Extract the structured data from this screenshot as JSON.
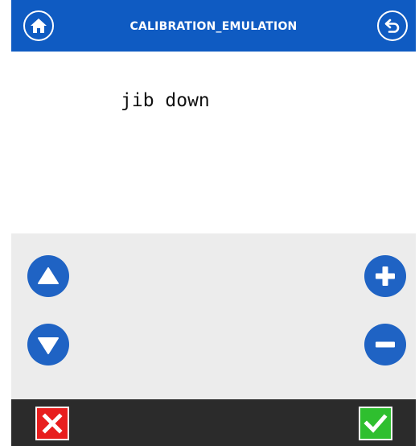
{
  "header": {
    "title": "CALIBRATION_EMULATION",
    "home_icon": "home-icon",
    "back_icon": "undo-back-icon",
    "background": "#0f5bc2"
  },
  "content": {
    "message": "jib down"
  },
  "controls": {
    "up_icon": "triangle-up-icon",
    "down_icon": "triangle-down-icon",
    "plus_icon": "plus-icon",
    "minus_icon": "minus-icon",
    "button_color": "#1f63c4",
    "panel_color": "#ececec"
  },
  "footer": {
    "cancel_icon": "x-icon",
    "confirm_icon": "check-icon",
    "cancel_color": "#e81e1e",
    "confirm_color": "#2fbf2f",
    "background": "#2b2b2b"
  }
}
